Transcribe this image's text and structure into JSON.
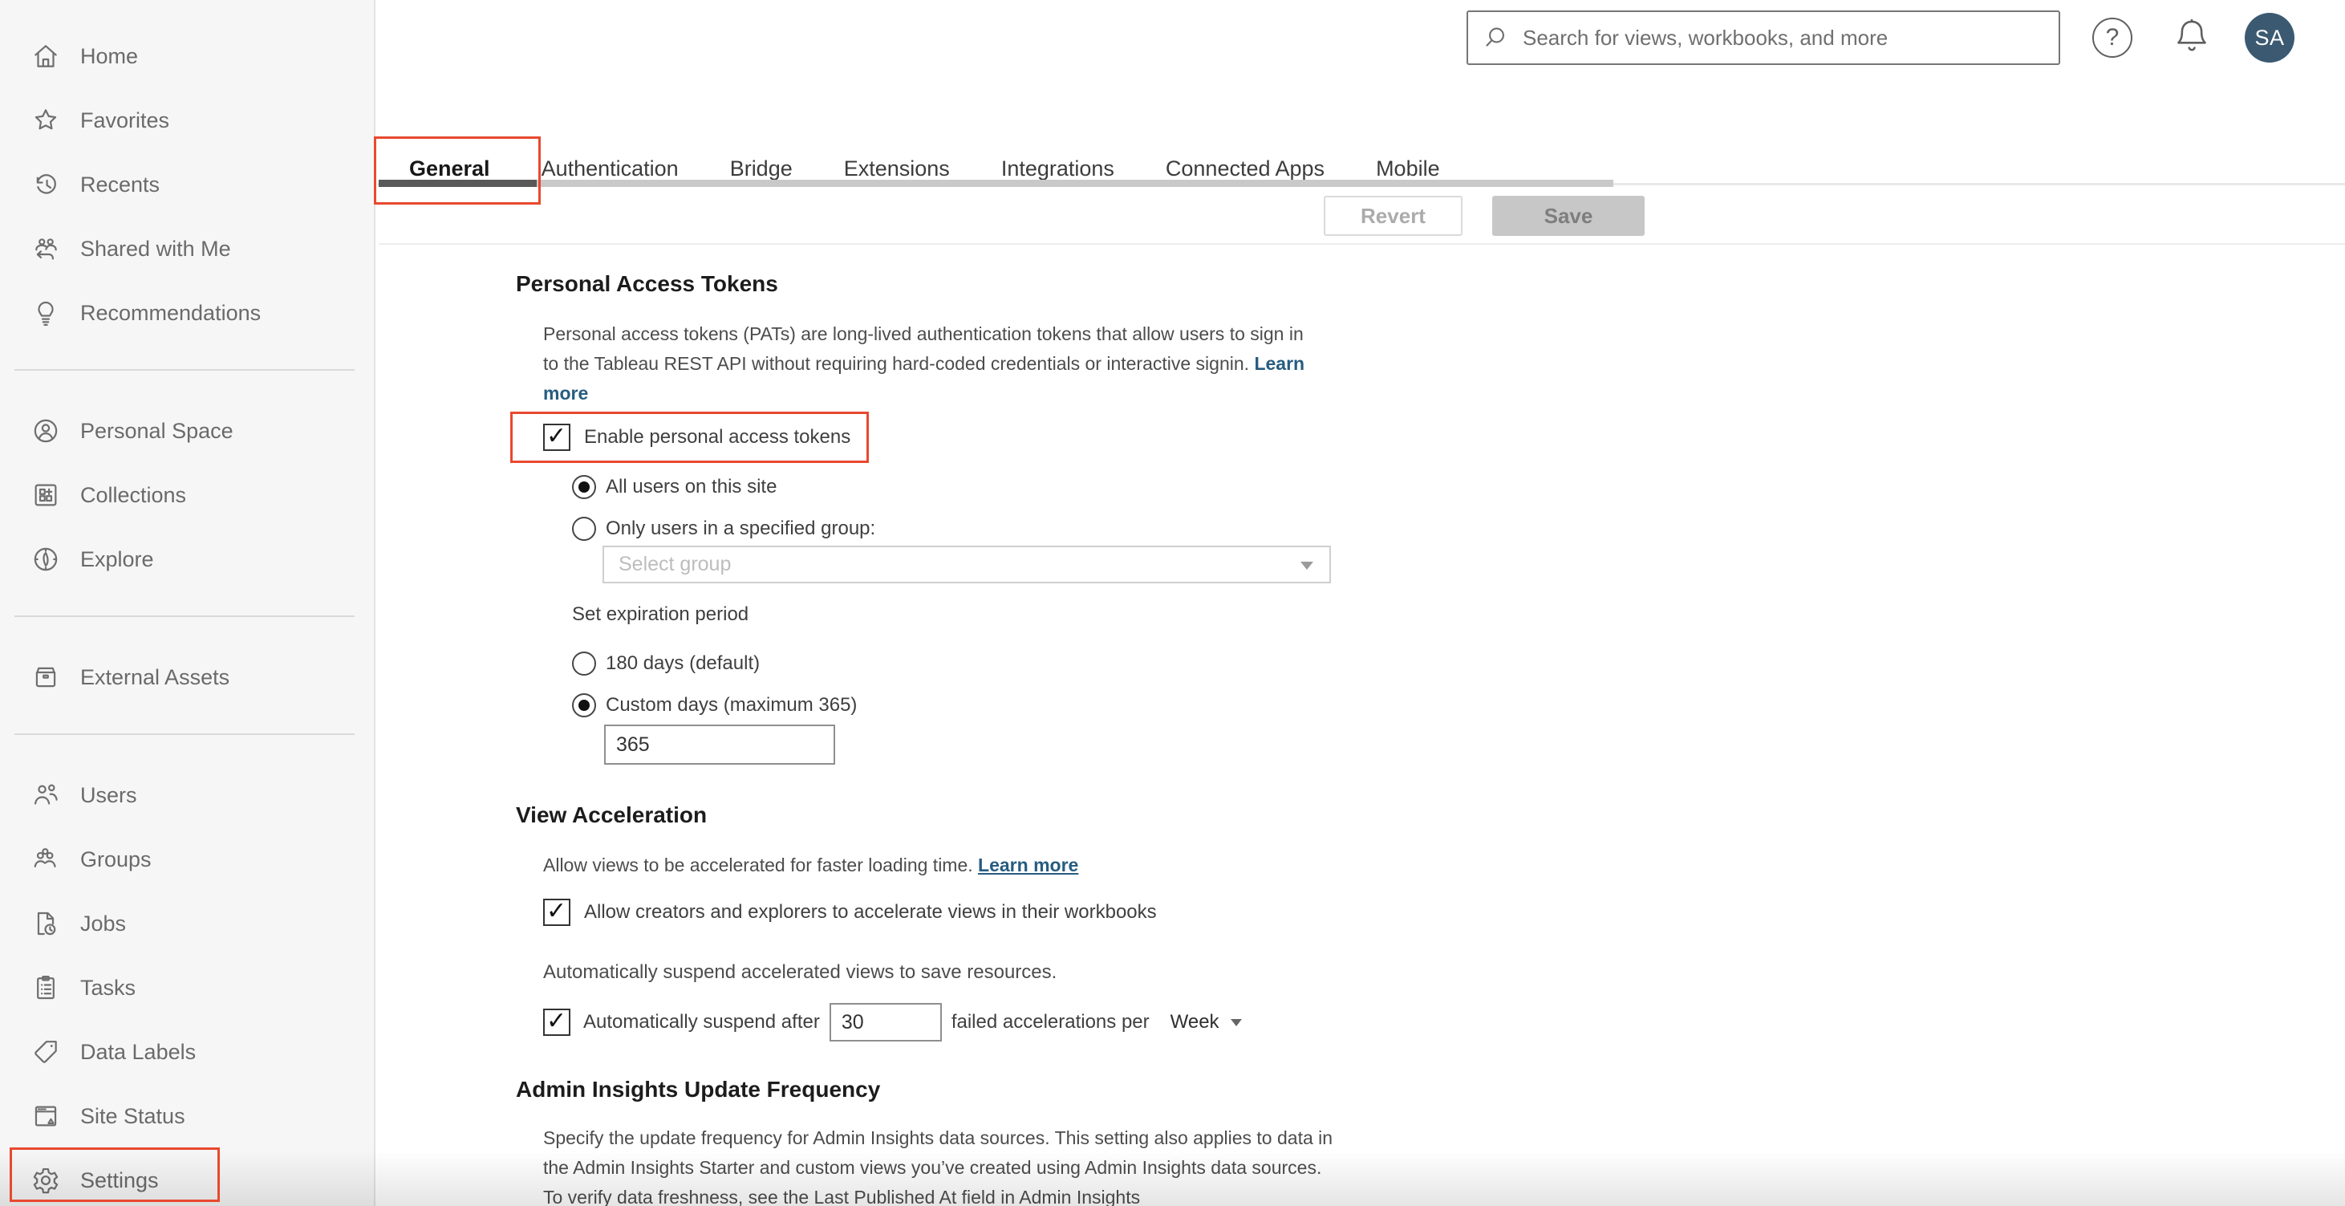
{
  "colors": {
    "accent_red": "#e8492f",
    "link_blue": "#275c7f",
    "avatar_bg": "#3b5a72"
  },
  "header": {
    "search_placeholder": "Search for views, workbooks, and more",
    "avatar_initials": "SA"
  },
  "sidebar": {
    "items": [
      {
        "label": "Home",
        "icon": "home-icon"
      },
      {
        "label": "Favorites",
        "icon": "star-icon"
      },
      {
        "label": "Recents",
        "icon": "history-icon"
      },
      {
        "label": "Shared with Me",
        "icon": "shared-with-me-icon"
      },
      {
        "label": "Recommendations",
        "icon": "lightbulb-icon"
      },
      {
        "label": "Personal Space",
        "icon": "person-circle-icon"
      },
      {
        "label": "Collections",
        "icon": "collections-icon"
      },
      {
        "label": "Explore",
        "icon": "compass-icon"
      },
      {
        "label": "External Assets",
        "icon": "archive-icon"
      },
      {
        "label": "Users",
        "icon": "users-icon"
      },
      {
        "label": "Groups",
        "icon": "groups-icon"
      },
      {
        "label": "Jobs",
        "icon": "document-clock-icon"
      },
      {
        "label": "Tasks",
        "icon": "clipboard-icon"
      },
      {
        "label": "Data Labels",
        "icon": "tag-icon"
      },
      {
        "label": "Site Status",
        "icon": "site-status-icon"
      },
      {
        "label": "Settings",
        "icon": "gear-icon"
      }
    ]
  },
  "tabs": {
    "items": [
      "General",
      "Authentication",
      "Bridge",
      "Extensions",
      "Integrations",
      "Connected Apps",
      "Mobile"
    ],
    "active": "General"
  },
  "toolbar": {
    "revert": "Revert",
    "save": "Save"
  },
  "pat": {
    "title": "Personal Access Tokens",
    "description": "Personal access tokens (PATs) are long-lived authentication tokens that allow users to sign in to the Tableau REST API without requiring hard-coded credentials or interactive signin.",
    "learn_more": "Learn more",
    "enable_checkbox": "Enable personal access tokens",
    "radio_all_users": "All users on this site",
    "radio_specified_group": "Only users in a specified group:",
    "group_select_placeholder": "Select group",
    "expiration_label": "Set expiration period",
    "radio_180": "180 days (default)",
    "radio_custom": "Custom days (maximum 365)",
    "custom_days_value": "365"
  },
  "view_acceleration": {
    "title": "View Acceleration",
    "description": "Allow views to be accelerated for faster loading time.",
    "learn_more": "Learn more",
    "allow_checkbox": "Allow creators and explorers to accelerate views in their workbooks",
    "suspend_description": "Automatically suspend accelerated views to save resources.",
    "suspend_prefix": "Automatically suspend after",
    "suspend_value": "30",
    "suspend_suffix": "failed accelerations per",
    "suspend_period": "Week"
  },
  "admin_insights": {
    "title": "Admin Insights Update Frequency",
    "description": "Specify the update frequency for Admin Insights data sources. This setting also applies to data in the Admin Insights Starter and custom views you’ve created using Admin Insights data sources. To verify data freshness, see the Last Published At field in Admin Insights"
  }
}
